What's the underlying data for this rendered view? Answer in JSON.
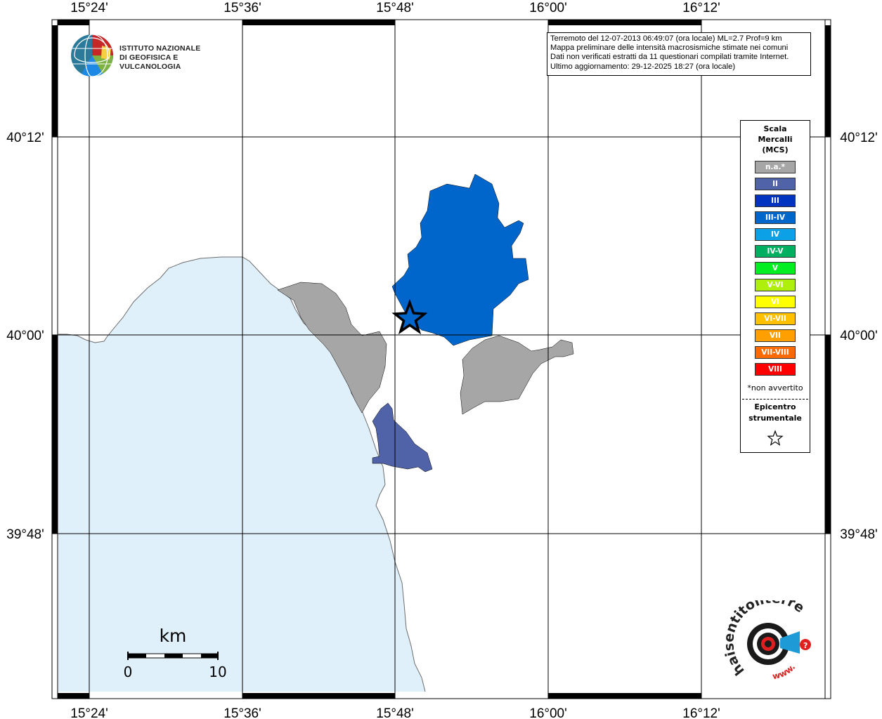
{
  "map": {
    "lon_labels": [
      "15°24'",
      "15°36'",
      "15°48'",
      "16°00'",
      "16°12'"
    ],
    "lat_labels": [
      "40°12'",
      "40°00'",
      "39°48'"
    ],
    "colors": {
      "sea": "#dff0fb",
      "grid": "#000000",
      "frame": "#000000",
      "coast": "#6c6c6c"
    }
  },
  "info": {
    "line1": "Terremoto del 12-07-2013 06:49:07 (ora locale) ML=2.7 Prof=9 km",
    "line2": "Mappa preliminare delle intensità macrosismiche stimate nei comuni",
    "line3": "Dati non verificati estratti da 11 questionari compilati tramite Internet.",
    "line4": "Ultimo aggiornamento: 29-12-2025 18:27 (ora locale)"
  },
  "legend": {
    "title_line1": "Scala",
    "title_line2": "Mercalli",
    "title_line3": "(MCS)",
    "items": [
      {
        "label": "n.a.*",
        "color": "#a6a6a6"
      },
      {
        "label": "II",
        "color": "#5163a8"
      },
      {
        "label": "III",
        "color": "#0033bf"
      },
      {
        "label": "III-IV",
        "color": "#0066cc"
      },
      {
        "label": "IV",
        "color": "#0ca0e6"
      },
      {
        "label": "IV-V",
        "color": "#00b060"
      },
      {
        "label": "V",
        "color": "#00ee22"
      },
      {
        "label": "V-VI",
        "color": "#aef00c"
      },
      {
        "label": "VI",
        "color": "#ffff00"
      },
      {
        "label": "VI-VII",
        "color": "#ffc000"
      },
      {
        "label": "VII",
        "color": "#ffa000"
      },
      {
        "label": "VII-VIII",
        "color": "#ff6a00"
      },
      {
        "label": "VIII",
        "color": "#ff0000"
      }
    ],
    "note": "*non avvertito",
    "epicenter_line1": "Epicentro",
    "epicenter_line2": "strumentale"
  },
  "scale_bar": {
    "unit": "km",
    "min_label": "0",
    "max_label": "10"
  },
  "ingv_logo": {
    "line1": "ISTITUTO NAZIONALE",
    "line2": "DI GEOFISICA E VULCANOLOGIA"
  },
  "hs_logo": {
    "text": "haisentitoilterremoto.it",
    "www": "www."
  },
  "regions": [
    {
      "name": "large-commune",
      "intensity": "III-IV"
    },
    {
      "name": "coastal-commune",
      "intensity": "n.a.*"
    },
    {
      "name": "east-commune",
      "intensity": "n.a.*"
    },
    {
      "name": "south-commune",
      "intensity": "II"
    }
  ]
}
